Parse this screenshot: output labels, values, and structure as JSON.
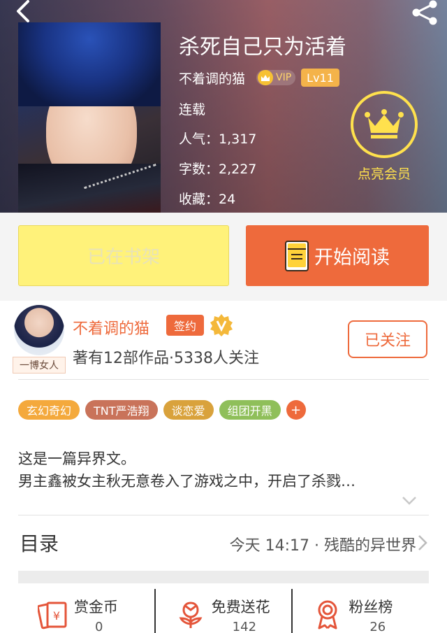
{
  "book": {
    "title": "杀死自己只为活着",
    "author": "不着调的猫",
    "vip_label": "VIP",
    "level": "Lv11",
    "status": "连载",
    "popularity": "人气：1,317",
    "word_count": "字数：2,227",
    "favorites": "收藏：24"
  },
  "member": {
    "label": "点亮会员"
  },
  "actions": {
    "shelf_label": "已在书架",
    "read_label": "开始阅读"
  },
  "author_card": {
    "name": "不着调的猫",
    "sign_label": "签约",
    "avatar_tag": "一博女人",
    "stats": "著有12部作品·5338人关注",
    "follow_label": "已关注"
  },
  "tags": [
    {
      "label": "玄幻奇幻",
      "color": "#f4a93c"
    },
    {
      "label": "TNT严浩翔",
      "color": "#c9735a"
    },
    {
      "label": "谈恋爱",
      "color": "#d9a23c"
    },
    {
      "label": "组团开黑",
      "color": "#8fbf5a"
    }
  ],
  "tag_add": "+",
  "synopsis": {
    "line1": "这是一篇异界文。",
    "line2": "男主鑫被女主秋无意卷入了游戏之中，开启了杀戮…"
  },
  "toc": {
    "label": "目录",
    "latest": "今天 14:17 · 残酷的异世界"
  },
  "stats": [
    {
      "name": "赏金币",
      "value": "0",
      "icon": "reward-coin-icon"
    },
    {
      "name": "免费送花",
      "value": "142",
      "icon": "flower-icon"
    },
    {
      "name": "粉丝榜",
      "value": "26",
      "icon": "fan-rank-icon"
    }
  ],
  "colors": {
    "accent": "#ee6a3c",
    "member_gold": "#ffe14d",
    "shelf_yellow": "#fff27a"
  }
}
